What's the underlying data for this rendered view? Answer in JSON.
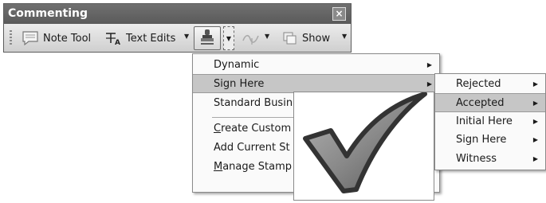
{
  "toolbar": {
    "title": "Commenting",
    "close_glyph": "×",
    "note_tool_label": "Note Tool",
    "text_edits_label": "Text Edits",
    "show_label": "Show",
    "icons": [
      "note-icon",
      "text-edits-icon",
      "stamp-icon",
      "attach-icon",
      "show-icon"
    ]
  },
  "stamp_menu": {
    "items": [
      {
        "label": "Dynamic",
        "has_submenu": true
      },
      {
        "label": "Sign Here",
        "has_submenu": true,
        "highlighted": true
      },
      {
        "label": "Standard Busin",
        "has_submenu": false
      },
      {
        "accel": "C",
        "rest": "reate Custom",
        "has_submenu": false
      },
      {
        "label": "Add Current St",
        "has_submenu": false
      },
      {
        "accel": "M",
        "rest": "anage Stamp",
        "has_submenu": false
      }
    ]
  },
  "sign_here_submenu": {
    "items": [
      {
        "label": "Rejected"
      },
      {
        "label": "Accepted",
        "highlighted": true
      },
      {
        "label": "Initial Here"
      },
      {
        "label": "Sign Here"
      },
      {
        "label": "Witness"
      }
    ]
  },
  "preview": {
    "icon": "checkmark-icon",
    "stroke_color": "#333333",
    "fill_color": "#8c8c8c"
  },
  "colors": {
    "title_bar": "#606060",
    "highlight": "#c6c6c6",
    "menu_bg": "#fafafa"
  }
}
